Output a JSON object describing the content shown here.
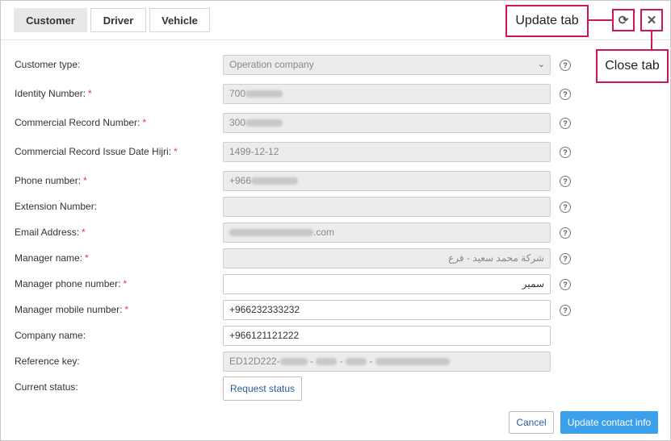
{
  "tabs": [
    "Customer",
    "Driver",
    "Vehicle"
  ],
  "callouts": {
    "update": "Update tab",
    "close": "Close tab"
  },
  "icons": {
    "refresh": "⟳",
    "close": "✕",
    "help": "?"
  },
  "form": {
    "customer_type": {
      "label": "Customer type:",
      "value": "Operation company"
    },
    "identity": {
      "label": "Identity Number:",
      "value": "700"
    },
    "cr_number": {
      "label": "Commercial Record Number:",
      "value": "300"
    },
    "cr_date": {
      "label": "Commercial Record Issue Date Hijri:",
      "value": "1499-12-12"
    },
    "phone": {
      "label": "Phone number:",
      "value": "+966"
    },
    "extension": {
      "label": "Extension Number:",
      "value": ""
    },
    "email": {
      "label": "Email Address:",
      "value": ".com"
    },
    "manager_name": {
      "label": "Manager name:",
      "value": "شركة محمد سعيد - فرع"
    },
    "manager_phone": {
      "label": "Manager phone number:",
      "value": "سمير"
    },
    "manager_mobile": {
      "label": "Manager mobile number:",
      "value": "+966232333232"
    },
    "company_name": {
      "label": "Company name:",
      "value": "+966121121222"
    },
    "reference_key": {
      "label": "Reference key:",
      "value": "ED12D222-"
    },
    "current_status": {
      "label": "Current status:",
      "button": "Request status"
    }
  },
  "required_mark": "*",
  "footer": {
    "cancel": "Cancel",
    "update": "Update contact info"
  }
}
